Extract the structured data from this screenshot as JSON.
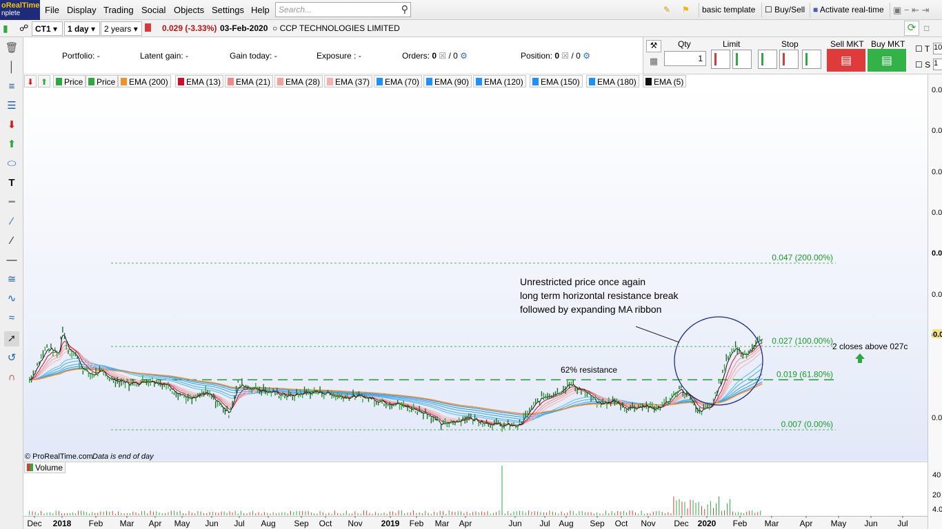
{
  "app": {
    "logo_line1": "oRealTime",
    "logo_line2": "nplete",
    "menu": [
      "File",
      "Display",
      "Trading",
      "Social",
      "Objects",
      "Settings",
      "Help"
    ],
    "search_placeholder": "Search...",
    "template": "basic template",
    "buysell": "Buy/Sell",
    "activate": "Activate real-time"
  },
  "toolbar": {
    "ticker": "CT1",
    "interval": "1 day",
    "range": "2 years",
    "price_change": "0.029 (-3.33%)",
    "date": "03-Feb-2020",
    "instrument": "CCP TECHNOLOGIES LIMITED"
  },
  "info": {
    "portfolio": "Portfolio: -",
    "latent_gain": "Latent gain: -",
    "gain_today": "Gain today: -",
    "exposure": "Exposure : -",
    "orders_label": "Orders:",
    "orders_a": "0",
    "orders_b": "/ 0",
    "position_label": "Position:",
    "position_a": "0",
    "position_b": "/ 0"
  },
  "order_panel": {
    "qty_label": "Qty",
    "qty_value": "1",
    "limit_label": "Limit",
    "stop_label": "Stop",
    "sell_mkt": "Sell MKT",
    "buy_mkt": "Buy MKT",
    "t_label": "T",
    "s_label": "S",
    "t_value": "10",
    "s_value": "1"
  },
  "legend": [
    {
      "label": "Price",
      "color": "#2fa83f"
    },
    {
      "label": "Price",
      "color": "#2fa83f"
    },
    {
      "label": "EMA (200)",
      "color": "#f0922b"
    },
    {
      "label": "EMA (13)",
      "color": "#c8102e"
    },
    {
      "label": "EMA (21)",
      "color": "#ef8a8a"
    },
    {
      "label": "EMA (28)",
      "color": "#f2a0a0"
    },
    {
      "label": "EMA (37)",
      "color": "#f5b0b0"
    },
    {
      "label": "EMA (70)",
      "color": "#1e90ff"
    },
    {
      "label": "EMA (90)",
      "color": "#1e90ff"
    },
    {
      "label": "EMA (120)",
      "color": "#1e90ff"
    },
    {
      "label": "EMA (150)",
      "color": "#1e90ff"
    },
    {
      "label": "EMA (180)",
      "color": "#1e90ff"
    },
    {
      "label": "EMA (5)",
      "color": "#111111"
    }
  ],
  "chart_data": {
    "type": "line",
    "title": "",
    "instrument": "CCP TECHNOLOGIES LIMITED",
    "x_ticks": [
      "Dec",
      "2018",
      "Feb",
      "Mar",
      "Apr",
      "May",
      "Jun",
      "Jul",
      "Aug",
      "Sep",
      "Oct",
      "Nov",
      "2019",
      "Feb",
      "Mar",
      "Apr",
      "Jun",
      "Jul",
      "Aug",
      "Sep",
      "Oct",
      "Nov",
      "Dec",
      "2020",
      "Feb",
      "Mar",
      "Apr",
      "May",
      "Jun",
      "Jul"
    ],
    "y_ticks": [
      "0.0",
      "0.0",
      "0.0",
      "0.0",
      "0.0",
      "0.0",
      "0.0",
      "0.0"
    ],
    "price_label": "0.0",
    "volume_ticks": [
      "40",
      "20",
      "4.0"
    ],
    "fib_levels": [
      {
        "label": "0.047 (200.00%)",
        "value": 0.047
      },
      {
        "label": "0.027 (100.00%)",
        "value": 0.027
      },
      {
        "label": "0.019 (61.80%)",
        "value": 0.019
      },
      {
        "label": "0.007 (0.00%)",
        "value": 0.007
      }
    ],
    "price_series": [
      {
        "x": "2017-12-01",
        "y": 0.019
      },
      {
        "x": "2017-12-20",
        "y": 0.027
      },
      {
        "x": "2018-01-02",
        "y": 0.025
      },
      {
        "x": "2018-01-05",
        "y": 0.032
      },
      {
        "x": "2018-01-12",
        "y": 0.026
      },
      {
        "x": "2018-01-20",
        "y": 0.025
      },
      {
        "x": "2018-01-26",
        "y": 0.022
      },
      {
        "x": "2018-02-05",
        "y": 0.02
      },
      {
        "x": "2018-02-15",
        "y": 0.021
      },
      {
        "x": "2018-03-01",
        "y": 0.019
      },
      {
        "x": "2018-03-20",
        "y": 0.018
      },
      {
        "x": "2018-04-10",
        "y": 0.019
      },
      {
        "x": "2018-04-25",
        "y": 0.018
      },
      {
        "x": "2018-05-10",
        "y": 0.016
      },
      {
        "x": "2018-05-25",
        "y": 0.014
      },
      {
        "x": "2018-06-10",
        "y": 0.016
      },
      {
        "x": "2018-06-25",
        "y": 0.013
      },
      {
        "x": "2018-07-05",
        "y": 0.011
      },
      {
        "x": "2018-07-15",
        "y": 0.018
      },
      {
        "x": "2018-08-01",
        "y": 0.017
      },
      {
        "x": "2018-08-20",
        "y": 0.016
      },
      {
        "x": "2018-09-10",
        "y": 0.015
      },
      {
        "x": "2018-09-25",
        "y": 0.016
      },
      {
        "x": "2018-10-15",
        "y": 0.016
      },
      {
        "x": "2018-11-01",
        "y": 0.015
      },
      {
        "x": "2018-11-25",
        "y": 0.015
      },
      {
        "x": "2018-12-15",
        "y": 0.014
      },
      {
        "x": "2019-01-05",
        "y": 0.013
      },
      {
        "x": "2019-01-20",
        "y": 0.012
      },
      {
        "x": "2019-02-05",
        "y": 0.011
      },
      {
        "x": "2019-02-20",
        "y": 0.008
      },
      {
        "x": "2019-03-05",
        "y": 0.009
      },
      {
        "x": "2019-03-20",
        "y": 0.01
      },
      {
        "x": "2019-04-05",
        "y": 0.009
      },
      {
        "x": "2019-04-25",
        "y": 0.008
      },
      {
        "x": "2019-05-15",
        "y": 0.008
      },
      {
        "x": "2019-05-28",
        "y": 0.012
      },
      {
        "x": "2019-06-10",
        "y": 0.015
      },
      {
        "x": "2019-06-25",
        "y": 0.016
      },
      {
        "x": "2019-07-10",
        "y": 0.018
      },
      {
        "x": "2019-07-25",
        "y": 0.016
      },
      {
        "x": "2019-08-10",
        "y": 0.013
      },
      {
        "x": "2019-08-25",
        "y": 0.014
      },
      {
        "x": "2019-09-10",
        "y": 0.012
      },
      {
        "x": "2019-09-25",
        "y": 0.013
      },
      {
        "x": "2019-10-10",
        "y": 0.012
      },
      {
        "x": "2019-10-25",
        "y": 0.014
      },
      {
        "x": "2019-11-05",
        "y": 0.017
      },
      {
        "x": "2019-11-15",
        "y": 0.015
      },
      {
        "x": "2019-11-25",
        "y": 0.011
      },
      {
        "x": "2019-12-10",
        "y": 0.013
      },
      {
        "x": "2019-12-20",
        "y": 0.019
      },
      {
        "x": "2019-12-28",
        "y": 0.025
      },
      {
        "x": "2020-01-05",
        "y": 0.027
      },
      {
        "x": "2020-01-12",
        "y": 0.025
      },
      {
        "x": "2020-01-20",
        "y": 0.026
      },
      {
        "x": "2020-01-28",
        "y": 0.028
      },
      {
        "x": "2020-02-03",
        "y": 0.029
      }
    ],
    "annotations": {
      "note_line1": "Unrestricted price once again",
      "note_line2": "long term horizontal resistance break",
      "note_line3": "followed by expanding MA ribbon",
      "resistance": "62% resistance",
      "closes": "2 closes above 027c",
      "copyright": "© ProRealTime.com",
      "eod": "Data is end of day",
      "volume_label": "Volume"
    }
  }
}
